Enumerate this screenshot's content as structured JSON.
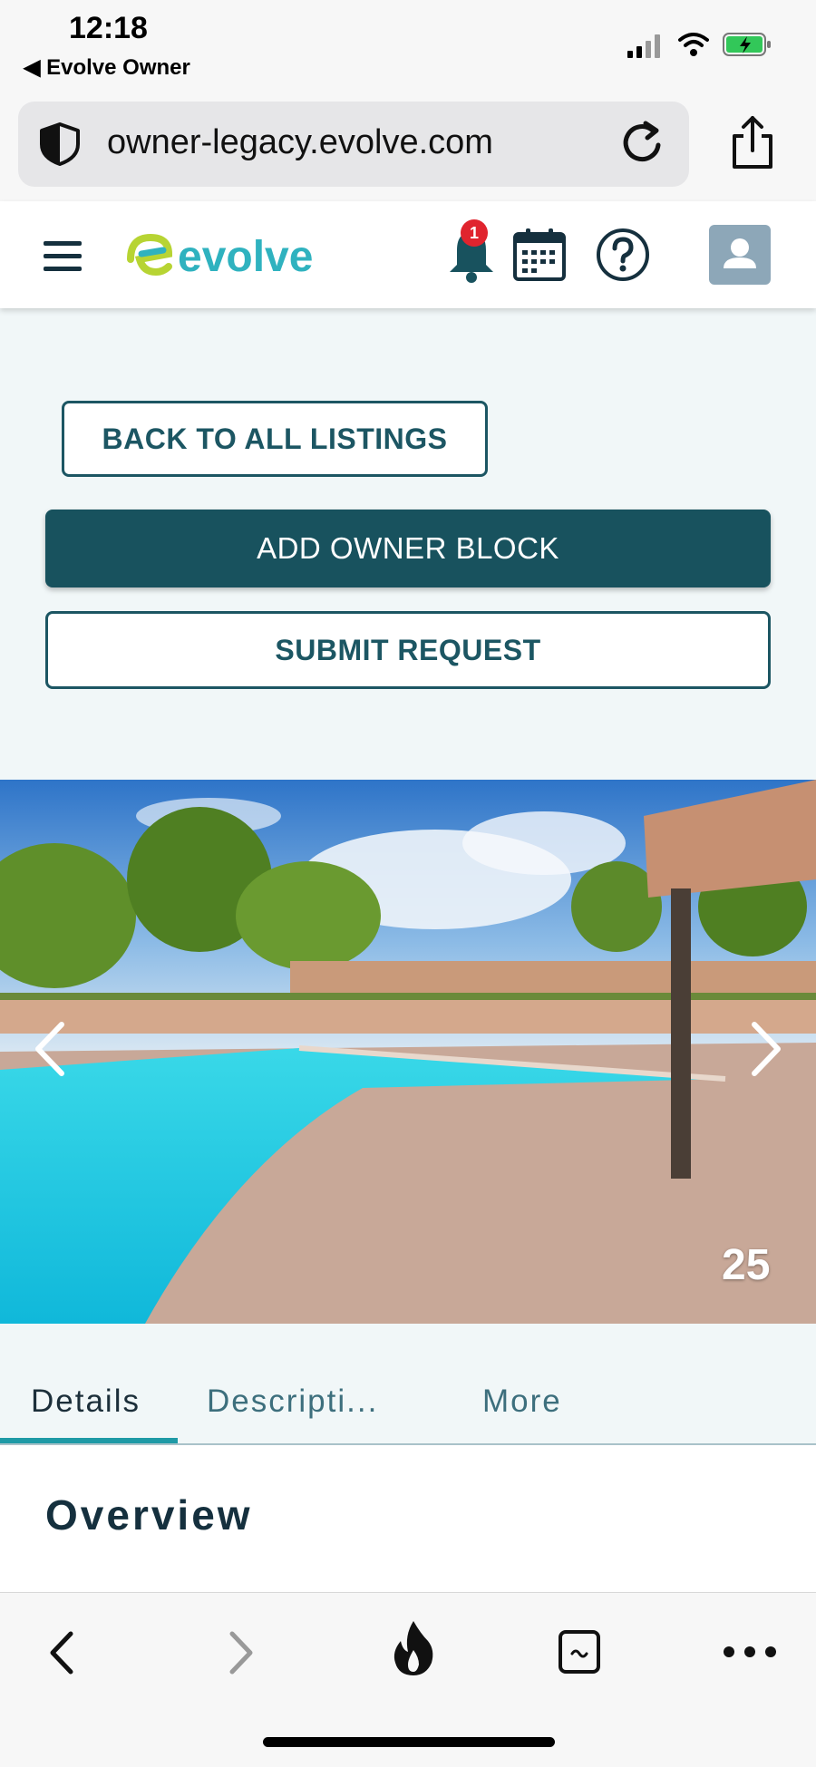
{
  "status_bar": {
    "time": "12:18",
    "back_app": "◀ Evolve Owner"
  },
  "browser": {
    "url": "owner-legacy.evolve.com"
  },
  "header": {
    "brand": "evolve",
    "notification_count": "1"
  },
  "actions": {
    "back_label": "BACK TO ALL LISTINGS",
    "add_block_label": "ADD OWNER BLOCK",
    "submit_label": "SUBMIT REQUEST"
  },
  "gallery": {
    "photo_count": "25"
  },
  "tabs": [
    {
      "label": "Details"
    },
    {
      "label": "Descripti..."
    },
    {
      "label": "More"
    }
  ],
  "content": {
    "section_title": "Overview"
  },
  "colors": {
    "primary": "#18525e",
    "accent": "#1f9aa6",
    "logo_green": "#b7d433",
    "logo_teal": "#2fb2bf",
    "badge": "#e0242e"
  }
}
